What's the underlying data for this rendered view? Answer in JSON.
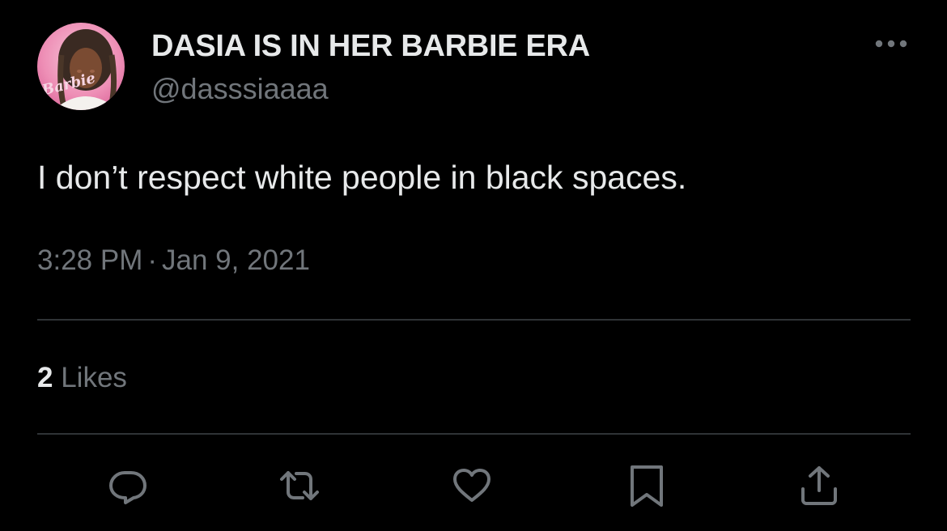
{
  "author": {
    "display_name": "DASIA IS IN HER BARBIE ERA",
    "handle": "@dasssiaaaa",
    "avatar_text": "Barbie"
  },
  "tweet": {
    "text": "I don’t respect white people in black spaces.",
    "time": "3:28 PM",
    "separator": "·",
    "date": "Jan 9, 2021"
  },
  "stats": {
    "likes_count": "2",
    "likes_label": "Likes"
  },
  "actions": {
    "icons": [
      "reply-icon",
      "retweet-icon",
      "like-icon",
      "bookmark-icon",
      "share-icon"
    ]
  },
  "colors": {
    "background": "#000000",
    "primary_text": "#e7e9ea",
    "secondary_text": "#71767b",
    "divider": "#2f3336",
    "avatar_pink": "#ee8fb6"
  }
}
